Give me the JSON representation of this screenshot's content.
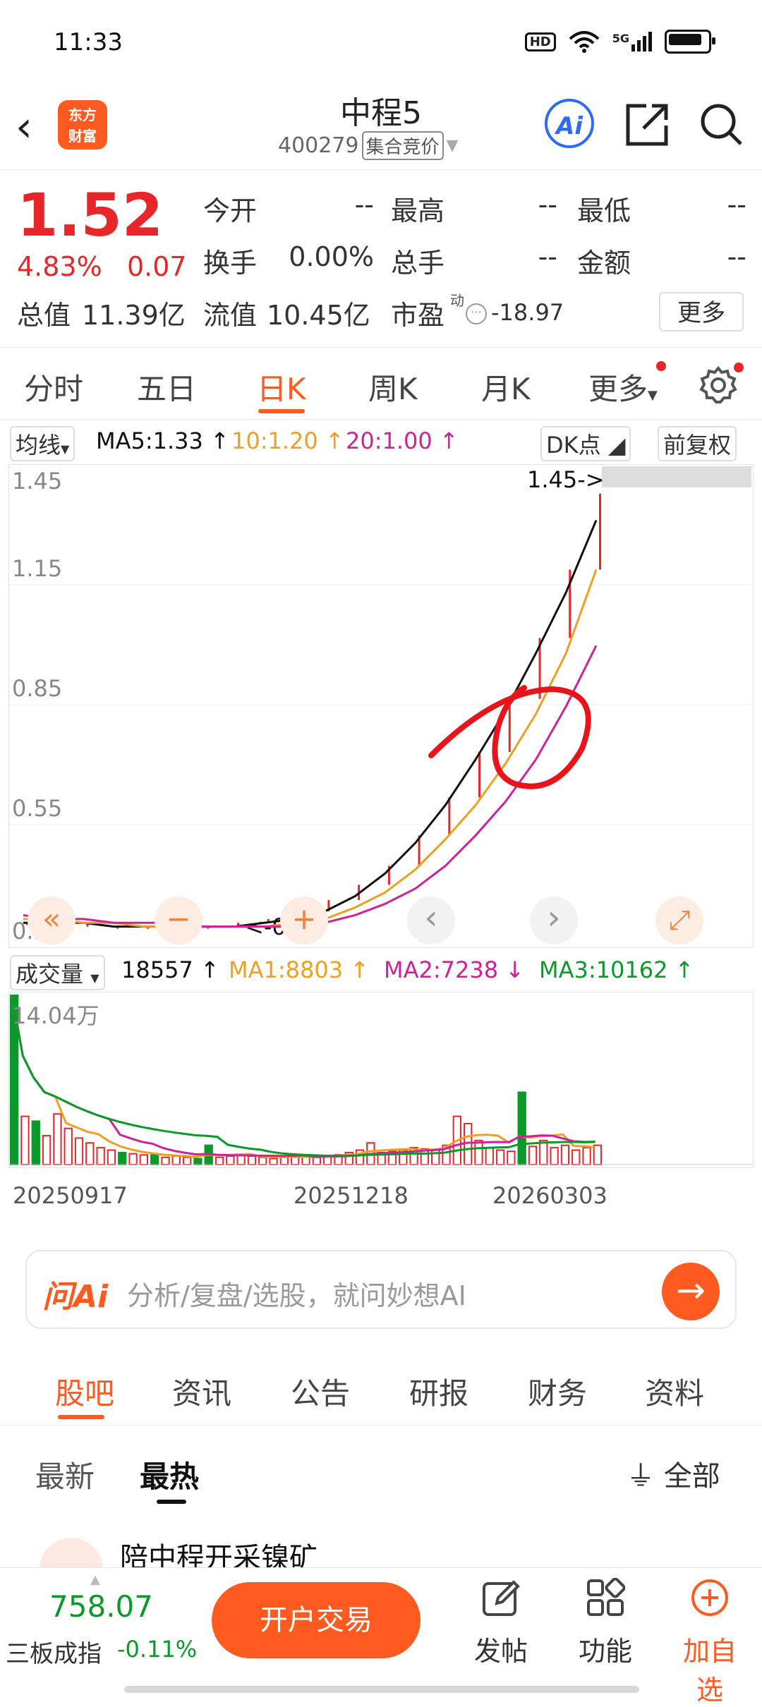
{
  "status_bar": {
    "time": "11:33",
    "hd": "HD",
    "network": "5G"
  },
  "header": {
    "stock_name": "中程5",
    "stock_code": "400279",
    "auction_label": "集合竞价",
    "logo_line1": "东方",
    "logo_line2": "财富",
    "ai_label": "Ai"
  },
  "quote": {
    "price": "1.52",
    "change_pct": "4.83%",
    "change_amt": "0.07",
    "fields": [
      {
        "label": "今开",
        "value": "--"
      },
      {
        "label": "最高",
        "value": "--"
      },
      {
        "label": "最低",
        "value": "--"
      },
      {
        "label": "换手",
        "value": "0.00%"
      },
      {
        "label": "总手",
        "value": "--"
      },
      {
        "label": "金额",
        "value": "--"
      }
    ],
    "total_value_label": "总值",
    "total_value": "11.39亿",
    "float_value_label": "流值",
    "float_value": "10.45亿",
    "pe_label": "市盈",
    "pe_sup": "动",
    "pe_value": "-18.97",
    "more_label": "更多"
  },
  "tabs": [
    {
      "label": "分时"
    },
    {
      "label": "五日"
    },
    {
      "label": "日K"
    },
    {
      "label": "周K"
    },
    {
      "label": "月K"
    },
    {
      "label": "更多"
    }
  ],
  "kline_indicators": {
    "selector": "均线",
    "ma5": "MA5:1.33",
    "ma10": "10:1.20",
    "ma20": "20:1.00",
    "dk_label": "DK点",
    "adjust_label": "前复权",
    "colors": {
      "ma5": "#111111",
      "ma10": "#f0a020",
      "ma20": "#d0209a",
      "up": "#e8262a",
      "down": "#0a9a2a"
    }
  },
  "chart_data": {
    "type": "line",
    "y_ticks": [
      "1.45",
      "1.15",
      "0.85",
      "0.55",
      "0.25"
    ],
    "ylim": [
      0.25,
      1.45
    ],
    "high_marker": "1.45->",
    "low_marker": "<-0.25",
    "x_ticks": [
      "20250917",
      "20251218",
      "20260303"
    ],
    "series": [
      {
        "name": "MA5",
        "values": [
          0.27,
          0.27,
          0.27,
          0.26,
          0.26,
          0.26,
          0.26,
          0.26,
          0.27,
          0.28,
          0.3,
          0.34,
          0.4,
          0.48,
          0.58,
          0.7,
          0.83,
          0.98,
          1.14,
          1.33
        ]
      },
      {
        "name": "MA10",
        "values": [
          0.28,
          0.28,
          0.27,
          0.27,
          0.26,
          0.26,
          0.26,
          0.26,
          0.26,
          0.27,
          0.28,
          0.31,
          0.35,
          0.41,
          0.49,
          0.58,
          0.69,
          0.82,
          0.98,
          1.2
        ]
      },
      {
        "name": "MA20",
        "values": [
          0.29,
          0.28,
          0.28,
          0.27,
          0.27,
          0.27,
          0.26,
          0.26,
          0.26,
          0.26,
          0.27,
          0.29,
          0.32,
          0.36,
          0.42,
          0.5,
          0.59,
          0.7,
          0.84,
          1.0
        ]
      }
    ],
    "candles_close": [
      0.27,
      0.27,
      0.26,
      0.26,
      0.26,
      0.26,
      0.26,
      0.27,
      0.28,
      0.3,
      0.33,
      0.37,
      0.42,
      0.5,
      0.6,
      0.72,
      0.86,
      1.02,
      1.2,
      1.4
    ]
  },
  "volume": {
    "selector": "成交量",
    "value": "18557",
    "ma1": "MA1:8803",
    "ma2": "MA2:7238",
    "ma3": "MA3:10162",
    "max_label": "14.04万",
    "bars": [
      14.04,
      4.0,
      3.6,
      2.4,
      4.2,
      3.0,
      2.2,
      1.8,
      1.4,
      1.2,
      1.0,
      0.9,
      0.8,
      0.8,
      0.6,
      0.7,
      0.6,
      0.5,
      1.6,
      0.6,
      0.7,
      0.8,
      0.7,
      0.6,
      0.5,
      0.6,
      0.7,
      0.8,
      0.6,
      0.7,
      0.8,
      1.0,
      1.2,
      1.8,
      1.0,
      1.1,
      1.2,
      1.4,
      1.3,
      1.2,
      1.6,
      4.0,
      3.4,
      2.0,
      1.4,
      1.2,
      1.1,
      6.0,
      1.5,
      2.0,
      1.4,
      1.6,
      1.2,
      1.4,
      1.6
    ],
    "bar_up": [
      false,
      true,
      false,
      true,
      true,
      true,
      true,
      true,
      true,
      true,
      false,
      true,
      true,
      false,
      true,
      true,
      true,
      false,
      false,
      true,
      true,
      true,
      true,
      true,
      true,
      true,
      true,
      true,
      true,
      true,
      true,
      true,
      true,
      true,
      true,
      true,
      true,
      true,
      true,
      true,
      true,
      true,
      true,
      true,
      true,
      true,
      true,
      false,
      true,
      true,
      true,
      true,
      true,
      true,
      true
    ]
  },
  "chart_controls": {
    "rewind": "«",
    "zoom_out": "−",
    "zoom_in": "+",
    "prev": "‹",
    "next": "›",
    "expand": "⤢"
  },
  "ai_bar": {
    "brand": "问Ai",
    "placeholder": "分析/复盘/选股，就问妙想AI"
  },
  "bottom_tabs": [
    {
      "label": "股吧"
    },
    {
      "label": "资讯"
    },
    {
      "label": "公告"
    },
    {
      "label": "研报"
    },
    {
      "label": "财务"
    },
    {
      "label": "资料"
    }
  ],
  "sub_tabs": [
    {
      "label": "最新"
    },
    {
      "label": "最热"
    }
  ],
  "filter_label": "全部",
  "post_title": "陪中程开采镍矿",
  "bottom_bar": {
    "index_value": "758.07",
    "index_name": "三板成指",
    "index_change": "-0.11%",
    "trade_label": "开户交易",
    "post_label": "发帖",
    "func_label": "功能",
    "watch_label": "加自选"
  }
}
